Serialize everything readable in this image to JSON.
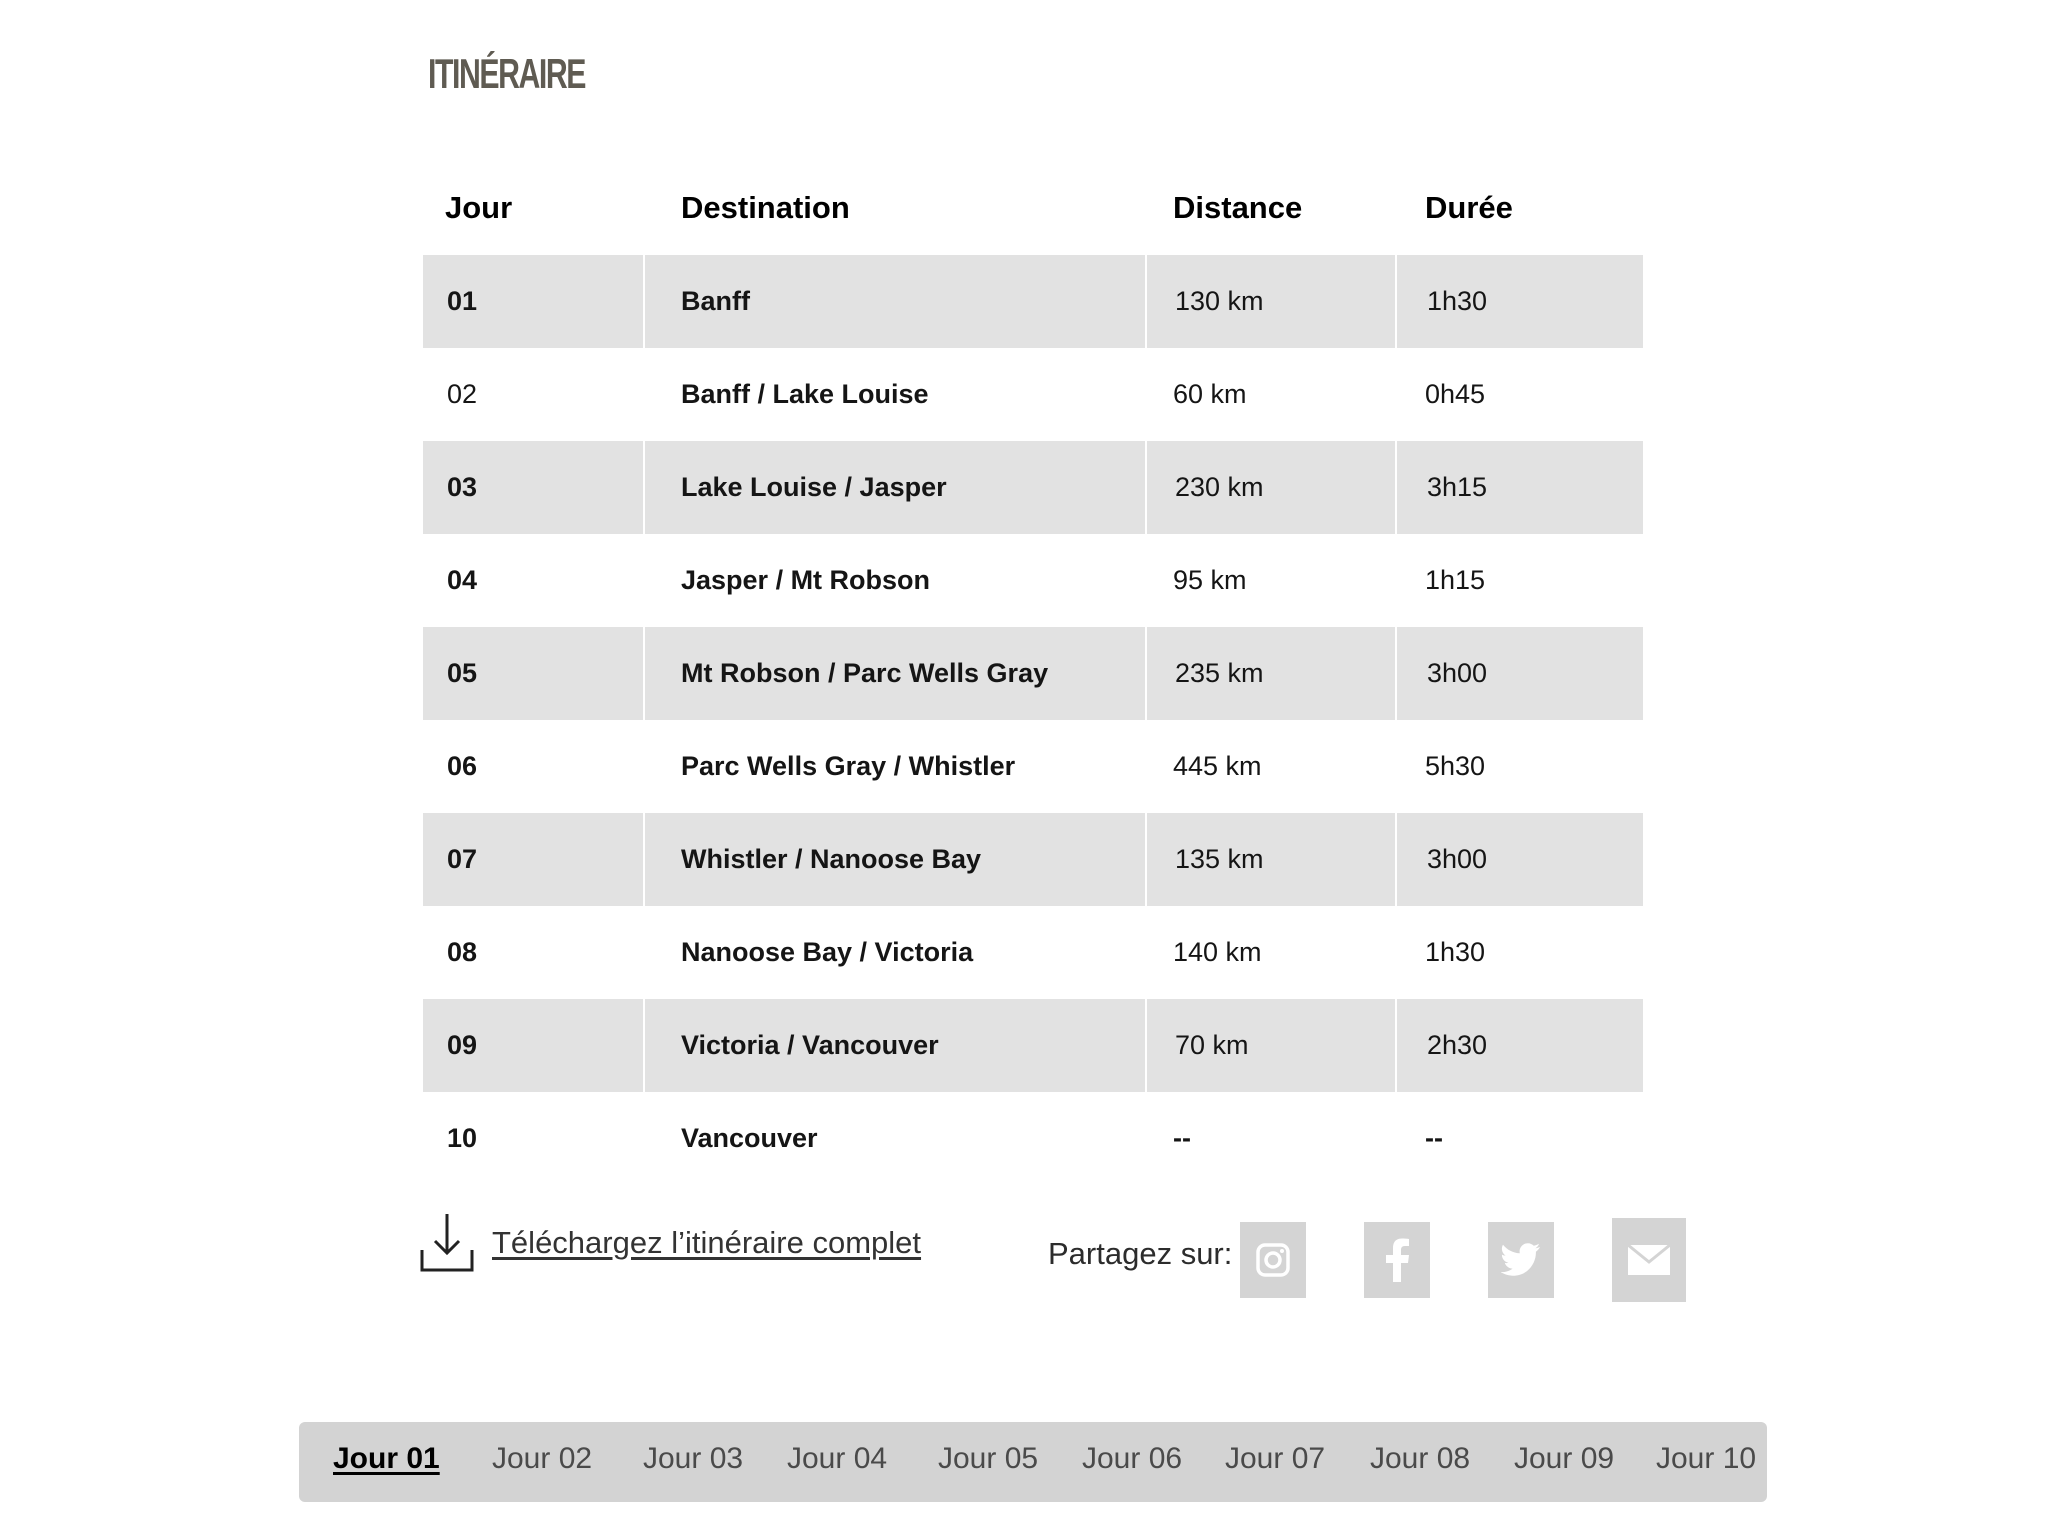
{
  "page": {
    "title": "ITINÉRAIRE"
  },
  "table": {
    "headers": {
      "jour": "Jour",
      "destination": "Destination",
      "distance": "Distance",
      "duree": "Durée"
    },
    "rows": [
      {
        "jour": "01",
        "destination": "Banff",
        "distance": "130 km",
        "duree": "1h30"
      },
      {
        "jour": "02",
        "destination": "Banff / Lake Louise",
        "distance": "60 km",
        "duree": "0h45"
      },
      {
        "jour": "03",
        "destination": "Lake Louise / Jasper",
        "distance": "230 km",
        "duree": "3h15"
      },
      {
        "jour": "04",
        "destination": "Jasper / Mt Robson",
        "distance": "95 km",
        "duree": "1h15"
      },
      {
        "jour": "05",
        "destination": "Mt Robson / Parc Wells Gray",
        "distance": "235 km",
        "duree": "3h00"
      },
      {
        "jour": "06",
        "destination": "Parc Wells Gray / Whistler",
        "distance": "445 km",
        "duree": "5h30"
      },
      {
        "jour": "07",
        "destination": "Whistler / Nanoose Bay",
        "distance": "135 km",
        "duree": "3h00"
      },
      {
        "jour": "08",
        "destination": "Nanoose Bay / Victoria",
        "distance": "140 km",
        "duree": "1h30"
      },
      {
        "jour": "09",
        "destination": "Victoria / Vancouver",
        "distance": "70 km",
        "duree": "2h30"
      },
      {
        "jour": "10",
        "destination": "Vancouver",
        "distance": "--",
        "duree": "--"
      }
    ]
  },
  "actions": {
    "download_label": "Téléchargez l’itinéraire complet",
    "download_icon": "download-icon",
    "share_label": "Partagez sur:",
    "share_buttons": [
      {
        "icon": "instagram-icon"
      },
      {
        "icon": "facebook-icon"
      },
      {
        "icon": "twitter-icon"
      },
      {
        "icon": "mail-icon"
      }
    ]
  },
  "day_tabs": {
    "items": [
      {
        "label": "Jour 01",
        "active": true
      },
      {
        "label": "Jour 02",
        "active": false
      },
      {
        "label": "Jour 03",
        "active": false
      },
      {
        "label": "Jour 04",
        "active": false
      },
      {
        "label": "Jour 05",
        "active": false
      },
      {
        "label": "Jour 06",
        "active": false
      },
      {
        "label": "Jour 07",
        "active": false
      },
      {
        "label": "Jour 08",
        "active": false
      },
      {
        "label": "Jour 09",
        "active": false
      },
      {
        "label": "Jour 10",
        "active": false
      }
    ]
  },
  "colors": {
    "row_shade": "#e2e2e2",
    "title": "#5f5b52",
    "share_button": "#d4d4d4",
    "tab_bar": "#d3d3d3"
  }
}
